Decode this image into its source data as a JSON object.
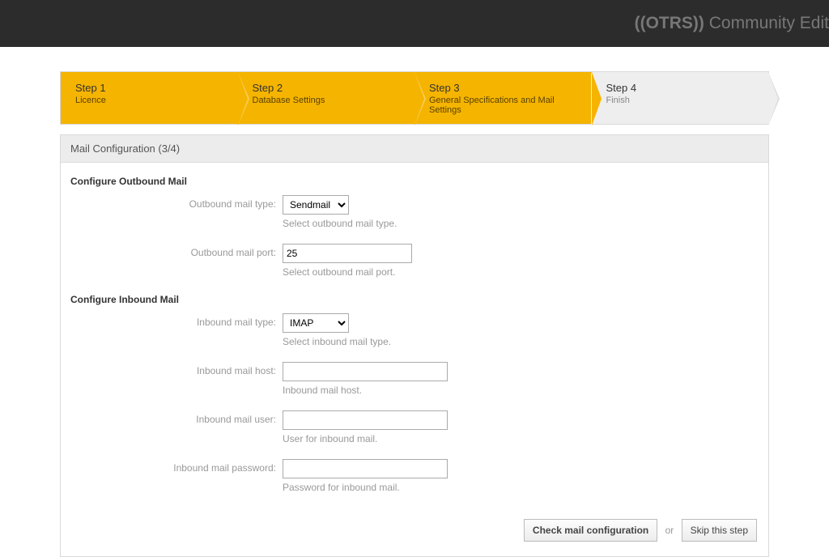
{
  "brand": {
    "strong": "((OTRS))",
    "rest": " Community Edition"
  },
  "steps": [
    {
      "num": "Step 1",
      "label": "Licence"
    },
    {
      "num": "Step 2",
      "label": "Database Settings"
    },
    {
      "num": "Step 3",
      "label": "General Specifications and Mail Settings"
    },
    {
      "num": "Step 4",
      "label": "Finish"
    }
  ],
  "panel_title": "Mail Configuration (3/4)",
  "outbound_hdr": "Configure Outbound Mail",
  "inbound_hdr": "Configure Inbound Mail",
  "fields": {
    "out_type_label": "Outbound mail type:",
    "out_type_value": "Sendmail",
    "out_type_hint": "Select outbound mail type.",
    "out_port_label": "Outbound mail port:",
    "out_port_value": "25",
    "out_port_hint": "Select outbound mail port.",
    "in_type_label": "Inbound mail type:",
    "in_type_value": "IMAP",
    "in_type_hint": "Select inbound mail type.",
    "in_host_label": "Inbound mail host:",
    "in_host_value": "",
    "in_host_hint": "Inbound mail host.",
    "in_user_label": "Inbound mail user:",
    "in_user_value": "",
    "in_user_hint": "User for inbound mail.",
    "in_pw_label": "Inbound mail password:",
    "in_pw_value": "",
    "in_pw_hint": "Password for inbound mail."
  },
  "actions": {
    "check": "Check mail configuration",
    "or": "or",
    "skip": "Skip this step"
  }
}
